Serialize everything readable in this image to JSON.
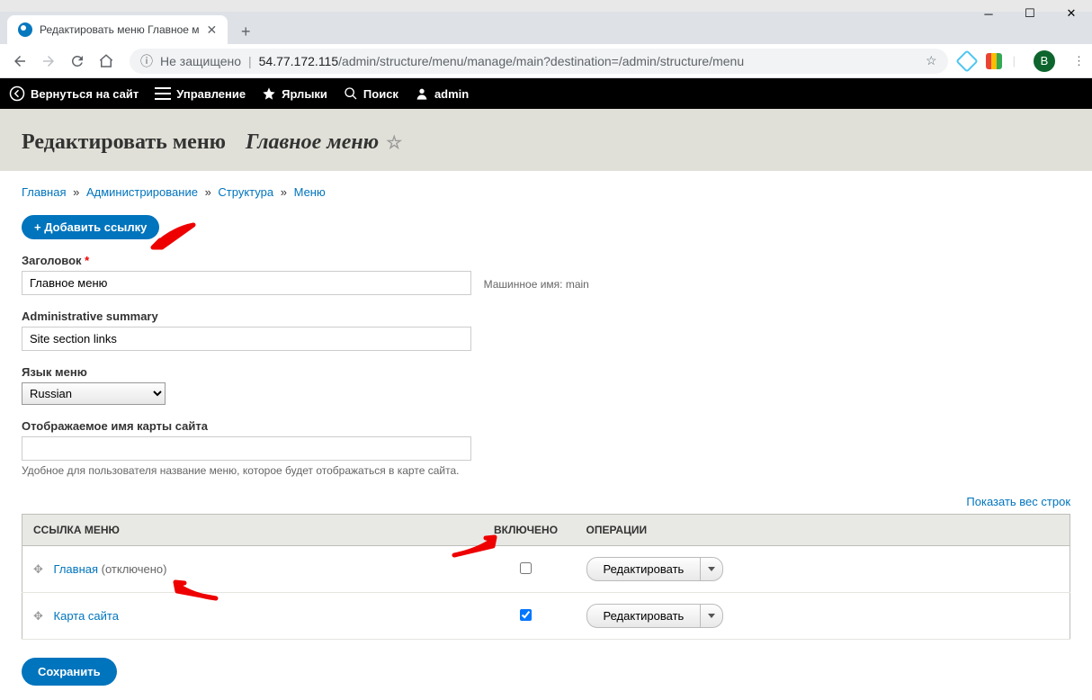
{
  "browser": {
    "tab_title": "Редактировать меню Главное м",
    "url_host": "54.77.172.115",
    "url_path": "/admin/structure/menu/manage/main?destination=/admin/structure/menu",
    "not_secure_label": "Не защищено",
    "profile_letter": "В"
  },
  "admin_bar": {
    "back_to_site": "Вернуться на сайт",
    "manage": "Управление",
    "shortcuts": "Ярлыки",
    "search": "Поиск",
    "user": "admin"
  },
  "page": {
    "title_prefix": "Редактировать меню",
    "title_em": "Главное меню"
  },
  "breadcrumb": {
    "home": "Главная",
    "admin": "Администрирование",
    "structure": "Структура",
    "menu": "Меню"
  },
  "actions": {
    "add_link": "+ Добавить ссылку",
    "save": "Сохранить",
    "show_weights": "Показать вес строк"
  },
  "form": {
    "title_label": "Заголовок",
    "title_value": "Главное меню",
    "machine_name_label": "Машинное имя:",
    "machine_name_value": "main",
    "summary_label": "Administrative summary",
    "summary_value": "Site section links",
    "lang_label": "Язык меню",
    "lang_value": "Russian",
    "sitemap_label": "Отображаемое имя карты сайта",
    "sitemap_value": "",
    "sitemap_desc": "Удобное для пользователя название меню, которое будет отображаться в карте сайта."
  },
  "table": {
    "headers": {
      "link": "ССЫЛКА МЕНЮ",
      "enabled": "ВКЛЮЧЕНО",
      "ops": "ОПЕРАЦИИ"
    },
    "rows": [
      {
        "label": "Главная",
        "suffix": "(отключено)",
        "enabled": false,
        "op": "Редактировать"
      },
      {
        "label": "Карта сайта",
        "suffix": "",
        "enabled": true,
        "op": "Редактировать"
      }
    ]
  }
}
